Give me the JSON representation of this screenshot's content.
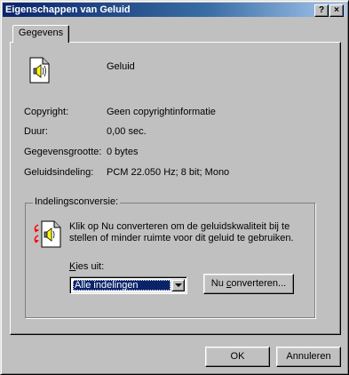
{
  "window": {
    "title": "Eigenschappen van Geluid",
    "help_glyph": "?",
    "close_glyph": "×"
  },
  "tabs": [
    {
      "label": "Gegevens",
      "selected": true
    }
  ],
  "file": {
    "name": "Geluid",
    "icon": "sound-file-icon"
  },
  "properties": [
    {
      "label": "Copyright:",
      "value": "Geen copyrightinformatie"
    },
    {
      "label": "Duur:",
      "value": "0,00 sec."
    },
    {
      "label": "Gegevensgrootte:",
      "value": "0 bytes"
    },
    {
      "label": "Geluidsindeling:",
      "value": "PCM 22.050 Hz; 8 bit; Mono"
    }
  ],
  "conversion": {
    "group_title": "Indelingsconversie:",
    "icon": "sound-convert-icon",
    "description": "Klik op Nu converteren om de geluidskwaliteit bij te stellen of minder ruimte voor dit geluid te gebruiken.",
    "choose_label_accel": "K",
    "choose_label_rest": "ies uit:",
    "format_selected": "Alle indelingen",
    "convert_button_pre": "Nu ",
    "convert_button_accel": "c",
    "convert_button_post": "onverteren..."
  },
  "buttons": {
    "ok": "OK",
    "cancel": "Annuleren"
  },
  "colors": {
    "titlebar_start": "#0a246a",
    "titlebar_end": "#a6caf0",
    "face": "#c0c0c0"
  }
}
